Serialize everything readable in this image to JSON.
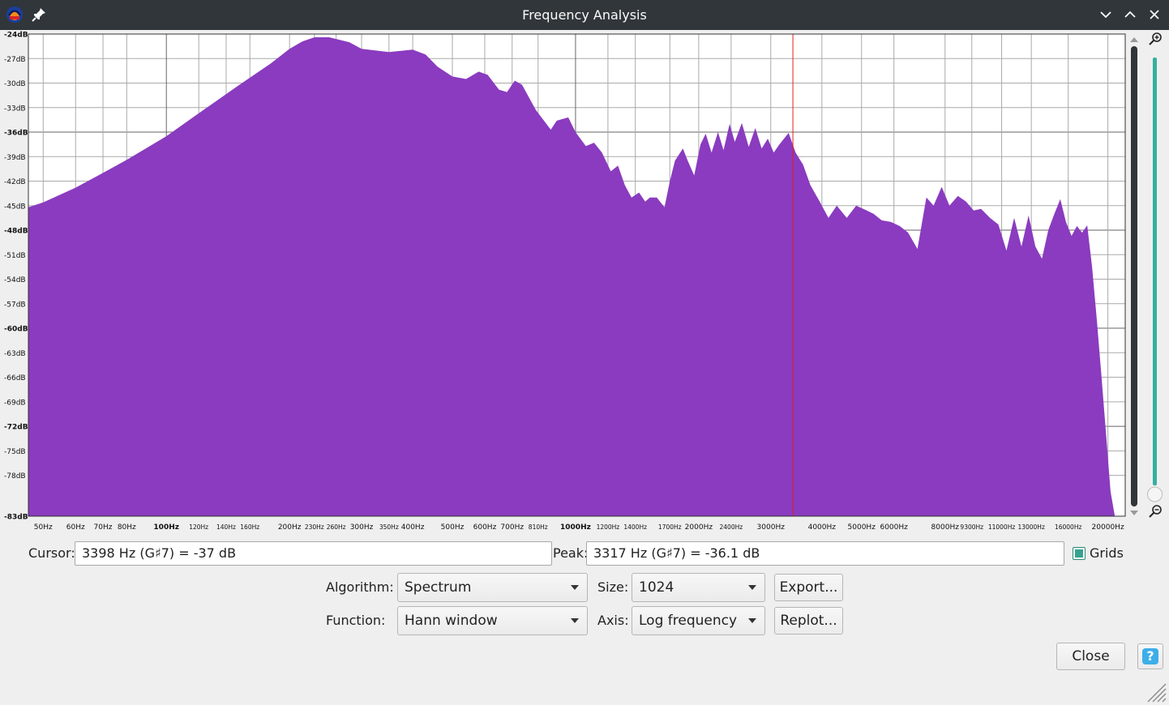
{
  "window": {
    "title": "Frequency Analysis",
    "icons": [
      "audacity-icon",
      "pin-icon",
      "minimize-icon",
      "maximize-icon",
      "close-icon"
    ]
  },
  "plot": {
    "fill_color": "#8a3bbf",
    "cursor_color": "#e02020",
    "grid_color": "#aaaaaa",
    "cursor_hz": 3398
  },
  "chart_data": {
    "type": "area",
    "xscale": "log",
    "xlim": [
      46,
      22050
    ],
    "ylim": [
      -83,
      -24
    ],
    "grid": true,
    "y_ticks": [
      {
        "v": -24,
        "label": "-24dB",
        "bold": true
      },
      {
        "v": -27,
        "label": "-27dB",
        "bold": false
      },
      {
        "v": -30,
        "label": "-30dB",
        "bold": false
      },
      {
        "v": -33,
        "label": "-33dB",
        "bold": false
      },
      {
        "v": -36,
        "label": "-36dB",
        "bold": true
      },
      {
        "v": -39,
        "label": "-39dB",
        "bold": false
      },
      {
        "v": -42,
        "label": "-42dB",
        "bold": false
      },
      {
        "v": -45,
        "label": "-45dB",
        "bold": false
      },
      {
        "v": -48,
        "label": "-48dB",
        "bold": true
      },
      {
        "v": -51,
        "label": "-51dB",
        "bold": false
      },
      {
        "v": -54,
        "label": "-54dB",
        "bold": false
      },
      {
        "v": -57,
        "label": "-57dB",
        "bold": false
      },
      {
        "v": -60,
        "label": "-60dB",
        "bold": true
      },
      {
        "v": -63,
        "label": "-63dB",
        "bold": false
      },
      {
        "v": -66,
        "label": "-66dB",
        "bold": false
      },
      {
        "v": -69,
        "label": "-69dB",
        "bold": false
      },
      {
        "v": -72,
        "label": "-72dB",
        "bold": true
      },
      {
        "v": -75,
        "label": "-75dB",
        "bold": false
      },
      {
        "v": -78,
        "label": "-78dB",
        "bold": false
      },
      {
        "v": -83,
        "label": "-83dB",
        "bold": true
      }
    ],
    "x_ticks": [
      {
        "v": 50,
        "label": "50Hz",
        "size": "m"
      },
      {
        "v": 60,
        "label": "60Hz",
        "size": "m"
      },
      {
        "v": 70,
        "label": "70Hz",
        "size": "m"
      },
      {
        "v": 80,
        "label": "80Hz",
        "size": "m"
      },
      {
        "v": 100,
        "label": "100Hz",
        "size": "b"
      },
      {
        "v": 120,
        "label": "120Hz",
        "size": "s"
      },
      {
        "v": 140,
        "label": "140Hz",
        "size": "s"
      },
      {
        "v": 160,
        "label": "160Hz",
        "size": "s"
      },
      {
        "v": 200,
        "label": "200Hz",
        "size": "m"
      },
      {
        "v": 230,
        "label": "230Hz",
        "size": "s"
      },
      {
        "v": 260,
        "label": "260Hz",
        "size": "s"
      },
      {
        "v": 300,
        "label": "300Hz",
        "size": "m"
      },
      {
        "v": 350,
        "label": "350Hz",
        "size": "s"
      },
      {
        "v": 400,
        "label": "400Hz",
        "size": "m"
      },
      {
        "v": 500,
        "label": "500Hz",
        "size": "m"
      },
      {
        "v": 600,
        "label": "600Hz",
        "size": "m"
      },
      {
        "v": 700,
        "label": "700Hz",
        "size": "m"
      },
      {
        "v": 810,
        "label": "810Hz",
        "size": "s"
      },
      {
        "v": 1000,
        "label": "1000Hz",
        "size": "b"
      },
      {
        "v": 1200,
        "label": "1200Hz",
        "size": "s"
      },
      {
        "v": 1400,
        "label": "1400Hz",
        "size": "s"
      },
      {
        "v": 1700,
        "label": "1700Hz",
        "size": "s"
      },
      {
        "v": 2000,
        "label": "2000Hz",
        "size": "m"
      },
      {
        "v": 2400,
        "label": "2400Hz",
        "size": "s"
      },
      {
        "v": 3000,
        "label": "3000Hz",
        "size": "m"
      },
      {
        "v": 4000,
        "label": "4000Hz",
        "size": "m"
      },
      {
        "v": 5000,
        "label": "5000Hz",
        "size": "m"
      },
      {
        "v": 6000,
        "label": "6000Hz",
        "size": "m"
      },
      {
        "v": 8000,
        "label": "8000Hz",
        "size": "m"
      },
      {
        "v": 9300,
        "label": "9300Hz",
        "size": "s"
      },
      {
        "v": 11000,
        "label": "11000Hz",
        "size": "s"
      },
      {
        "v": 13000,
        "label": "13000Hz",
        "size": "s"
      },
      {
        "v": 16000,
        "label": "16000Hz",
        "size": "s"
      },
      {
        "v": 20000,
        "label": "20000Hz",
        "size": "m"
      }
    ],
    "x": [
      46,
      50,
      60,
      70,
      80,
      100,
      120,
      150,
      180,
      200,
      215,
      230,
      250,
      280,
      300,
      350,
      400,
      430,
      460,
      500,
      540,
      580,
      610,
      650,
      680,
      710,
      740,
      800,
      870,
      900,
      960,
      1000,
      1060,
      1110,
      1160,
      1220,
      1270,
      1320,
      1370,
      1430,
      1480,
      1520,
      1580,
      1650,
      1700,
      1750,
      1830,
      1880,
      1950,
      2020,
      2080,
      2150,
      2230,
      2300,
      2380,
      2450,
      2550,
      2650,
      2750,
      2850,
      2950,
      3050,
      3150,
      3317,
      3450,
      3600,
      3750,
      3950,
      4150,
      4350,
      4600,
      4850,
      5100,
      5350,
      5600,
      5900,
      6200,
      6500,
      6850,
      7200,
      7500,
      7850,
      8200,
      8600,
      9000,
      9400,
      9800,
      10300,
      10800,
      11300,
      11800,
      12300,
      12800,
      13300,
      13800,
      14300,
      14800,
      15300,
      15800,
      16300,
      16800,
      17300,
      17800,
      18300,
      18800,
      19300,
      19800,
      20300,
      20800,
      21300,
      22050
    ],
    "y": [
      -45.2,
      -44.6,
      -42.8,
      -41.0,
      -39.4,
      -36.5,
      -33.7,
      -30.3,
      -27.6,
      -25.8,
      -24.9,
      -24.4,
      -24.4,
      -25.0,
      -25.8,
      -26.2,
      -25.9,
      -26.5,
      -28.0,
      -29.2,
      -29.5,
      -28.6,
      -29.0,
      -30.8,
      -31.1,
      -29.7,
      -30.2,
      -33.3,
      -35.7,
      -34.6,
      -34.2,
      -36.0,
      -37.7,
      -37.3,
      -38.5,
      -40.8,
      -40.1,
      -42.5,
      -44.0,
      -43.4,
      -44.5,
      -44.0,
      -44.0,
      -45.2,
      -42.0,
      -39.5,
      -38.0,
      -39.5,
      -41.3,
      -37.5,
      -36.2,
      -38.5,
      -36.0,
      -38.2,
      -35.0,
      -37.2,
      -34.9,
      -37.8,
      -35.5,
      -38.0,
      -36.8,
      -38.5,
      -37.5,
      -36.1,
      -38.5,
      -40.0,
      -42.5,
      -44.5,
      -46.5,
      -45.0,
      -46.5,
      -45.0,
      -45.5,
      -46.0,
      -46.8,
      -47.0,
      -47.5,
      -48.3,
      -50.3,
      -44.0,
      -45.0,
      -42.7,
      -45.0,
      -43.8,
      -44.5,
      -45.6,
      -45.4,
      -46.5,
      -47.3,
      -50.5,
      -46.5,
      -50.0,
      -46.2,
      -50.0,
      -51.5,
      -48.0,
      -46.0,
      -44.2,
      -47.0,
      -48.7,
      -47.5,
      -48.3,
      -47.4,
      -52.5,
      -59.0,
      -66.0,
      -73.0,
      -80.0,
      -83.0,
      -83.0,
      -83.0,
      -83.0,
      -83.0
    ]
  },
  "form": {
    "cursor_label": "Cursor:",
    "cursor_value": "3398 Hz (G♯7) = -37 dB",
    "peak_label": "Peak:",
    "peak_value": "3317 Hz (G♯7) = -36.1 dB",
    "grids_label": "Grids",
    "grids_checked": true,
    "algorithm_label": "Algorithm:",
    "algorithm_value": "Spectrum",
    "size_label": "Size:",
    "size_value": "1024",
    "export_label": "Export...",
    "function_label": "Function:",
    "function_value": "Hann window",
    "axis_label": "Axis:",
    "axis_value": "Log frequency",
    "replot_label": "Replot...",
    "close_label": "Close",
    "help_symbol": "?"
  }
}
